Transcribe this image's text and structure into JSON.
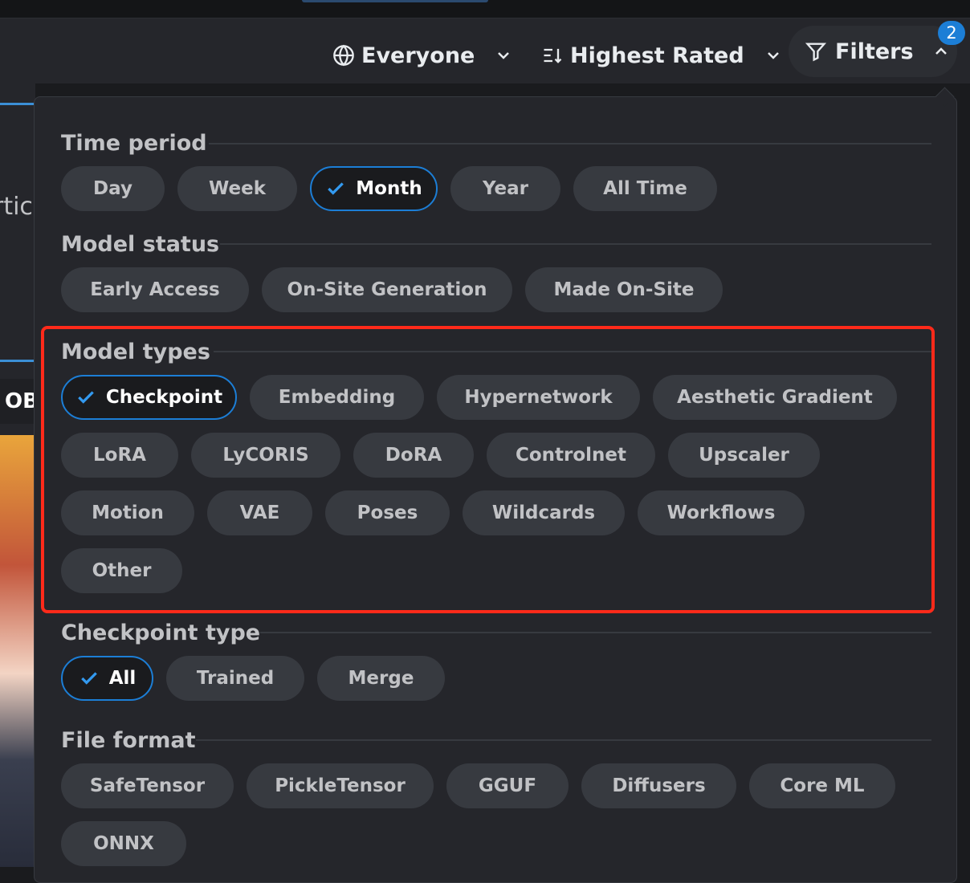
{
  "toolbar": {
    "audience_label": "Everyone",
    "audience_icon": "globe-icon",
    "sort_label": "Highest Rated",
    "sort_icon": "sort-icon",
    "filters_label": "Filters",
    "filters_icon": "funnel-icon",
    "filters_badge": "2"
  },
  "background": {
    "partial_text": "rtic",
    "partial_card_text": "OB"
  },
  "filters": {
    "time_period": {
      "title": "Time period",
      "options": [
        "Day",
        "Week",
        "Month",
        "Year",
        "All Time"
      ],
      "selected": "Month"
    },
    "model_status": {
      "title": "Model status",
      "options": [
        "Early Access",
        "On-Site Generation",
        "Made On-Site"
      ]
    },
    "model_types": {
      "title": "Model types",
      "options": [
        "Checkpoint",
        "Embedding",
        "Hypernetwork",
        "Aesthetic Gradient",
        "LoRA",
        "LyCORIS",
        "DoRA",
        "Controlnet",
        "Upscaler",
        "Motion",
        "VAE",
        "Poses",
        "Wildcards",
        "Workflows",
        "Other"
      ],
      "selected": "Checkpoint"
    },
    "checkpoint_type": {
      "title": "Checkpoint type",
      "options": [
        "All",
        "Trained",
        "Merge"
      ],
      "selected": "All"
    },
    "file_format": {
      "title": "File format",
      "options": [
        "SafeTensor",
        "PickleTensor",
        "GGUF",
        "Diffusers",
        "Core ML",
        "ONNX"
      ]
    }
  },
  "colors": {
    "accent": "#1c7ed6",
    "highlight_box": "#ff2a1a",
    "chip_bg": "#373a40",
    "panel_bg": "#25262b"
  }
}
